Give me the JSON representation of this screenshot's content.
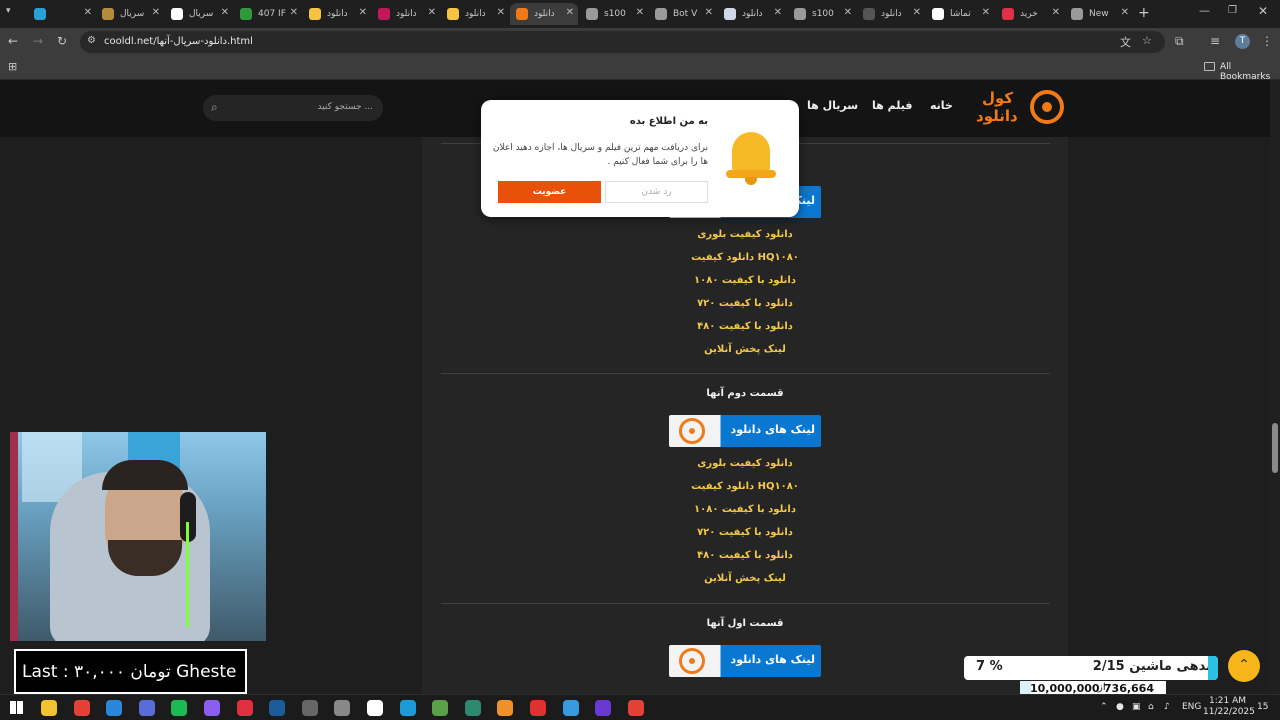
{
  "browser": {
    "tabs": [
      {
        "label": "",
        "active": false,
        "color": "#2aa0d8"
      },
      {
        "label": "سریال",
        "active": false,
        "color": "#b58c3c"
      },
      {
        "label": "سریال",
        "active": false,
        "color": "#ffffff"
      },
      {
        "label": "407 IF",
        "active": false,
        "color": "#2e9a3a"
      },
      {
        "label": "دانلود",
        "active": false,
        "color": "#f6c343"
      },
      {
        "label": "دانلود",
        "active": false,
        "color": "#c2185b"
      },
      {
        "label": "دانلود",
        "active": false,
        "color": "#f6c343"
      },
      {
        "label": "دانلود",
        "active": true,
        "color": "#f07a18"
      },
      {
        "label": "s100",
        "active": false,
        "color": "#9a9a9a"
      },
      {
        "label": "Bot V",
        "active": false,
        "color": "#9a9a9a"
      },
      {
        "label": "دانلود",
        "active": false,
        "color": "#d0d8e8"
      },
      {
        "label": "s100",
        "active": false,
        "color": "#9a9a9a"
      },
      {
        "label": "دانلود",
        "active": false,
        "color": "#555555"
      },
      {
        "label": "تماشا",
        "active": false,
        "color": "#ffffff"
      },
      {
        "label": "خرید",
        "active": false,
        "color": "#e0304a"
      },
      {
        "label": "New",
        "active": false,
        "color": "#9a9a9a"
      }
    ],
    "url": "cooldl.net/دانلود-سریال-آنها.html",
    "bookmarks_label": "All Bookmarks",
    "profile_initial": "T"
  },
  "site": {
    "logo": {
      "line1": "کول",
      "line2": "دانلود"
    },
    "nav": {
      "home": "خانه",
      "movies": "فیلم ها",
      "series": "سریال ها"
    },
    "search_placeholder": "جستجو کنید ...",
    "banner_text": "لینک های دانلود",
    "sections": [
      {
        "title": "",
        "links": [
          "دانلود کیفیت بلوری",
          "دانلود کیفیت HQ۱۰۸۰",
          "دانلود با کیفیت ۱۰۸۰",
          "دانلود با کیفیت ۷۲۰",
          "دانلود با کیفیت ۴۸۰",
          "لینک پخش آنلاین"
        ]
      },
      {
        "title": "قسمت دوم آنها",
        "links": [
          "دانلود کیفیت بلوری",
          "دانلود کیفیت HQ۱۰۸۰",
          "دانلود با کیفیت ۱۰۸۰",
          "دانلود با کیفیت ۷۲۰",
          "دانلود با کیفیت ۴۸۰",
          "لینک پخش آنلاین"
        ]
      },
      {
        "title": "قسمت اول آنها",
        "links": []
      }
    ]
  },
  "popup": {
    "title": "به من اطلاع بده",
    "body": "برای دریافت مهم ترین فیلم و سریال ها، اجازه دهید اعلان ها را برای شما فعال کنیم .",
    "deny_label": "رد شدن",
    "join_label": "عضویت"
  },
  "overlay": {
    "banner_text": "Last :  ۳۰,۰۰۰ تومان  Gheste",
    "debt_label": "بدهی ماشین 2/15",
    "debt_pct": "7 %",
    "progress_current": "736,664",
    "progress_sep": "از",
    "progress_total": "10,000,000",
    "progress_fraction": 0.074
  },
  "taskbar": {
    "language": "ENG",
    "time": "1:21 AM",
    "date": "11/22/2025",
    "notifications": "15"
  },
  "colors": {
    "accent": "#f4c84a",
    "banner_blue": "#0a78d1",
    "logo_orange": "#f07a18",
    "join_button": "#e9510b"
  }
}
